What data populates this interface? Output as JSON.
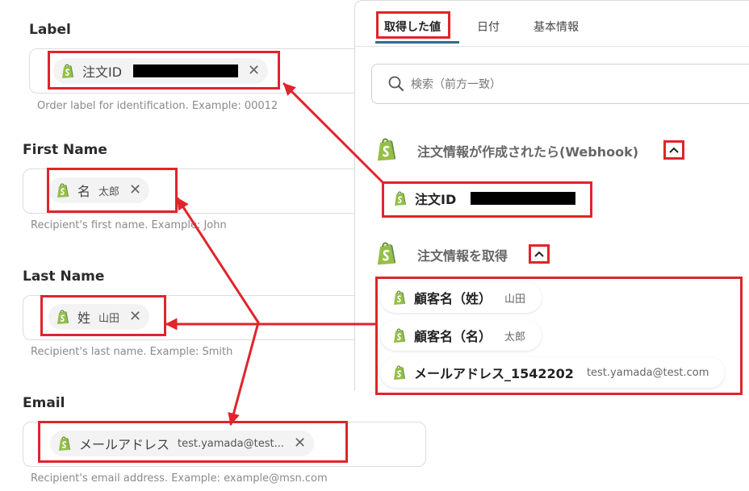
{
  "form": {
    "label": {
      "title": "Label",
      "chip_name": "注文ID",
      "help": "Order label for identification. Example: 00012"
    },
    "first_name": {
      "title": "First Name",
      "chip_name": "名",
      "chip_value": "太郎",
      "help": "Recipient's first name. Example: John"
    },
    "last_name": {
      "title": "Last Name",
      "chip_name": "姓",
      "chip_value": "山田",
      "help": "Recipient's last name. Example: Smith"
    },
    "email": {
      "title": "Email",
      "chip_name": "メールアドレス",
      "chip_value": "test.yamada@test...",
      "help": "Recipient's email address. Example: example@msn.com"
    }
  },
  "panel": {
    "tabs": [
      "取得した値",
      "日付",
      "基本情報"
    ],
    "search_placeholder": "検索（前方一致）",
    "section1": {
      "title": "注文情報が作成されたら(Webhook)",
      "items": [
        {
          "name": "注文ID"
        }
      ]
    },
    "section2": {
      "title": "注文情報を取得",
      "items": [
        {
          "name": "顧客名（姓）",
          "value": "山田"
        },
        {
          "name": "顧客名（名）",
          "value": "太郎"
        },
        {
          "name": "メールアドレス_1542202",
          "value": "test.yamada@test.com"
        }
      ]
    }
  },
  "colors": {
    "highlight": "#e0242b",
    "shopify_green": "#95bf47",
    "shopify_dark": "#5e8e3e"
  },
  "icons": {
    "field_chip": "shopify-icon",
    "remove": "close-icon",
    "search": "search-icon",
    "collapse": "chevron-up-icon"
  }
}
